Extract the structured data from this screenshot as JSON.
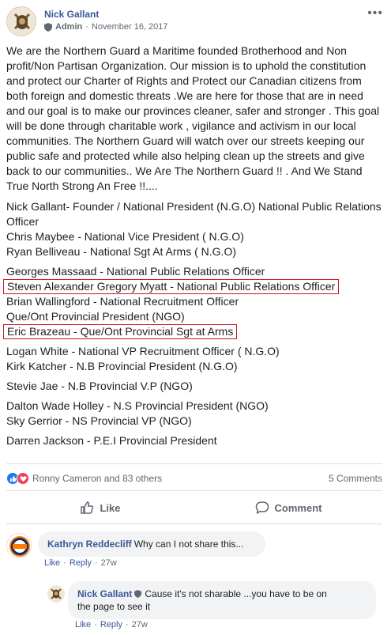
{
  "post": {
    "author": "Nick Gallant",
    "role": "Admin",
    "date": "November 16, 2017",
    "intro_lines": [
      "We are the Northern Guard a Maritime founded Brotherhood and Non",
      "profit/Non Partisan Organization. Our mission is to uphold the constitution",
      "and protect our Charter of Rights and Protect our Canadian citizens from",
      "both foreign and domestic threats .We are here for those that are in need",
      "and our goal is to make our provinces cleaner, safer and stronger . This goal",
      "will be done through charitable work , vigilance and activism in our local",
      "communities. The Northern Guard will watch over our streets keeping our",
      "public safe and protected while also helping clean up the streets and give",
      "back to our communities.. We Are The Northern Guard !! . And We Stand",
      "True North Strong An Free !!...."
    ],
    "roster": {
      "founder_1": "Nick Gallant- Founder / National President (N.G.O) National Public Relations",
      "founder_2": "Officer",
      "vp": "Chris Maybee - National Vice President ( N.G.O)",
      "sgt": "Ryan Belliveau - National Sgt At Arms ( N.G.O)",
      "pr": "Georges Massaad - National Public Relations Officer",
      "pr2": "Steven Alexander Gregory Myatt - National Public Relations Officer",
      "recruit": "Brian Wallingford - National Recruitment Officer",
      "queont_pres": "Que/Ont Provincial President (NGO)",
      "queont_sgt": "Eric Brazeau - Que/Ont Provincial Sgt at Arms",
      "vp_recruit": "Logan White - National VP Recruitment Officer ( N.G.O)",
      "nb_pres": "Kirk Katcher - N.B Provincial President (N.G.O)",
      "nb_vp": "Stevie Jae - N.B Provincial V.P (NGO)",
      "ns_pres": "Dalton Wade Holley - N.S Provincial President (NGO)",
      "ns_vp": "Sky Gerrior - NS Provincial VP (NGO)",
      "pei_pres": "Darren Jackson - P.E.I Provincial President"
    },
    "reactions_text": "Ronny Cameron and 83 others",
    "comments_count": "5 Comments",
    "like_label": "Like",
    "comment_label": "Comment"
  },
  "comments": [
    {
      "name": "Kathryn Reddecliff",
      "text": "Why can I not share this...",
      "like": "Like",
      "reply": "Reply",
      "time": "27w"
    },
    {
      "name": "Nick Gallant",
      "text_1": "Cause it's not sharable ...you have to be on",
      "text_2": "the page to see it",
      "like": "Like",
      "reply": "Reply",
      "time": "27w"
    }
  ],
  "colors": {
    "link": "#385898",
    "highlight_box": "#d0121a",
    "like_blue": "#1877f2",
    "love_red": "#f33e58"
  },
  "icons": [
    "more-options-icon",
    "admin-shield-icon",
    "like-reaction-icon",
    "love-reaction-icon",
    "thumbs-up-icon",
    "comment-icon",
    "oilers-logo-avatar",
    "northern-guard-crest-avatar"
  ]
}
